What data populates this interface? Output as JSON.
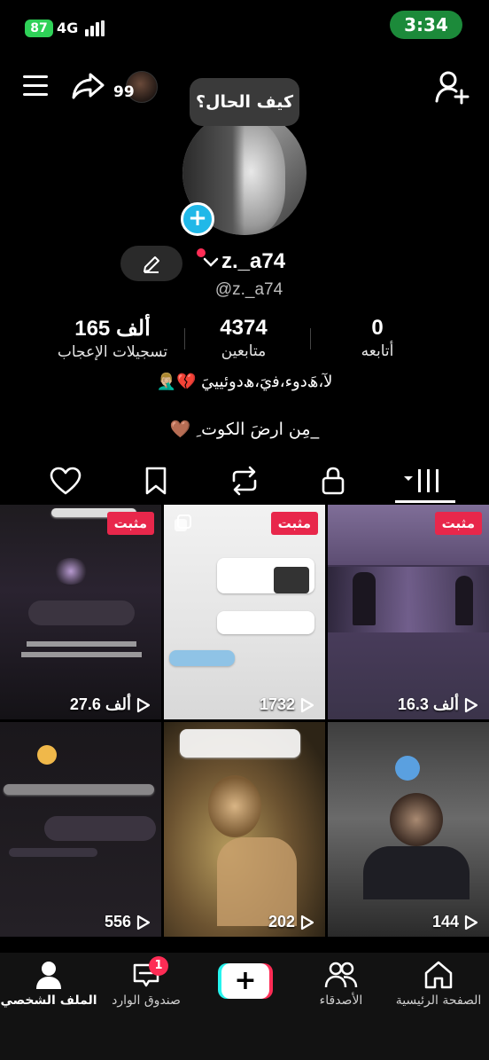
{
  "status_bar": {
    "battery": "87",
    "network": "4G",
    "time": "3:34",
    "colors": {
      "battery": "#2fd158",
      "time_pill": "#1c8a3a"
    }
  },
  "top_bar": {
    "views_count": "99",
    "icons": [
      "menu-icon",
      "share-icon",
      "add-friend-icon"
    ]
  },
  "profile": {
    "note": "كيف الحال؟",
    "display_name": "z._a74",
    "handle": "@z._a74",
    "stats": {
      "likes": {
        "value": "165 ألف",
        "label": "تسجيلات الإعجاب"
      },
      "followers": {
        "value": "4374",
        "label": "متابعين"
      },
      "following": {
        "value": "0",
        "label": "أتابعه"
      }
    },
    "bio_line1": "ﻟﺂ،ﮪَدوء،ﻓيَ،ﮪدوئيييَ 💔🤦🏼‍♂️",
    "bio_line2": "_مِن ارضَ الكوت ِ 🤎"
  },
  "tabs": [
    "liked-heart",
    "bookmarks",
    "reposts",
    "private-lock",
    "videos-grid"
  ],
  "grid": [
    {
      "pinned_label": "مثبت",
      "plays": "27.6 ألف"
    },
    {
      "pinned_label": "مثبت",
      "plays": "1732"
    },
    {
      "pinned_label": "مثبت",
      "plays": "16.3 ألف"
    },
    {
      "plays": "556"
    },
    {
      "plays": "202"
    },
    {
      "plays": "144"
    }
  ],
  "bottom_nav": {
    "profile": "الملف الشخصي",
    "inbox": "صندوق الوارد",
    "inbox_badge": "1",
    "create": "+",
    "friends": "الأصدقاء",
    "home": "الصفحة الرئيسية",
    "colors": {
      "create_left": "#25f4ee",
      "create_right": "#fe2c55",
      "badge": "#fe2c55"
    }
  }
}
